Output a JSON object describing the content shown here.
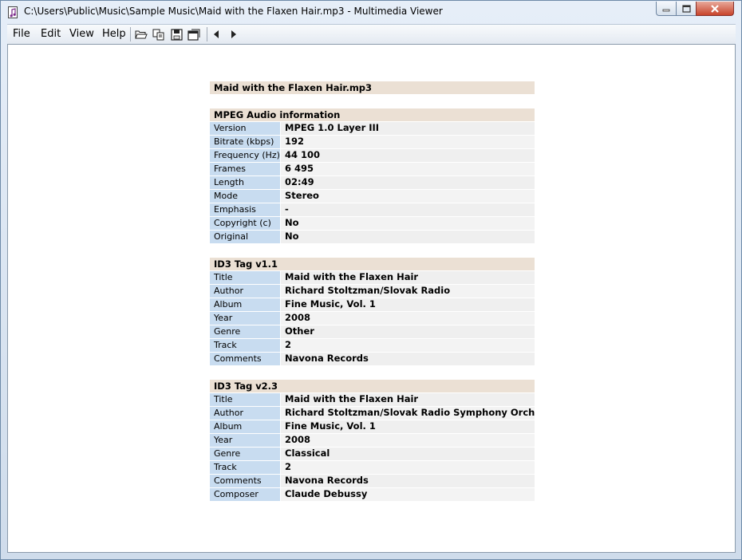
{
  "window": {
    "title": "C:\\Users\\Public\\Music\\Sample Music\\Maid with the Flaxen Hair.mp3 - Multimedia Viewer"
  },
  "menu": [
    "File",
    "Edit",
    "View",
    "Help"
  ],
  "toolbar": {
    "icons": [
      "open-folder-icon",
      "copy-icon",
      "save-icon",
      "window-icon",
      "previous-icon",
      "next-icon"
    ]
  },
  "file_title": "Maid with the Flaxen Hair.mp3",
  "sections": [
    {
      "title": "MPEG Audio information",
      "rows": [
        {
          "label": "Version",
          "value": "MPEG 1.0 Layer III"
        },
        {
          "label": "Bitrate (kbps)",
          "value": "192"
        },
        {
          "label": "Frequency (Hz)",
          "value": "44 100"
        },
        {
          "label": "Frames",
          "value": "6 495"
        },
        {
          "label": "Length",
          "value": "02:49"
        },
        {
          "label": "Mode",
          "value": "Stereo"
        },
        {
          "label": "Emphasis",
          "value": "-"
        },
        {
          "label": "Copyright (c)",
          "value": "No"
        },
        {
          "label": "Original",
          "value": "No"
        }
      ]
    },
    {
      "title": "ID3 Tag v1.1",
      "rows": [
        {
          "label": "Title",
          "value": "Maid with the Flaxen Hair"
        },
        {
          "label": "Author",
          "value": "Richard Stoltzman/Slovak Radio"
        },
        {
          "label": "Album",
          "value": "Fine Music, Vol. 1"
        },
        {
          "label": "Year",
          "value": "2008"
        },
        {
          "label": "Genre",
          "value": "Other"
        },
        {
          "label": "Track",
          "value": "2"
        },
        {
          "label": "Comments",
          "value": "Navona Records"
        }
      ]
    },
    {
      "title": "ID3 Tag v2.3",
      "rows": [
        {
          "label": "Title",
          "value": "Maid with the Flaxen Hair"
        },
        {
          "label": "Author",
          "value": "Richard Stoltzman/Slovak Radio Symphony Orchestra"
        },
        {
          "label": "Album",
          "value": "Fine Music, Vol. 1"
        },
        {
          "label": "Year",
          "value": "2008"
        },
        {
          "label": "Genre",
          "value": "Classical"
        },
        {
          "label": "Track",
          "value": "2"
        },
        {
          "label": "Comments",
          "value": "Navona Records"
        },
        {
          "label": "Composer",
          "value": "Claude Debussy"
        }
      ]
    }
  ]
}
